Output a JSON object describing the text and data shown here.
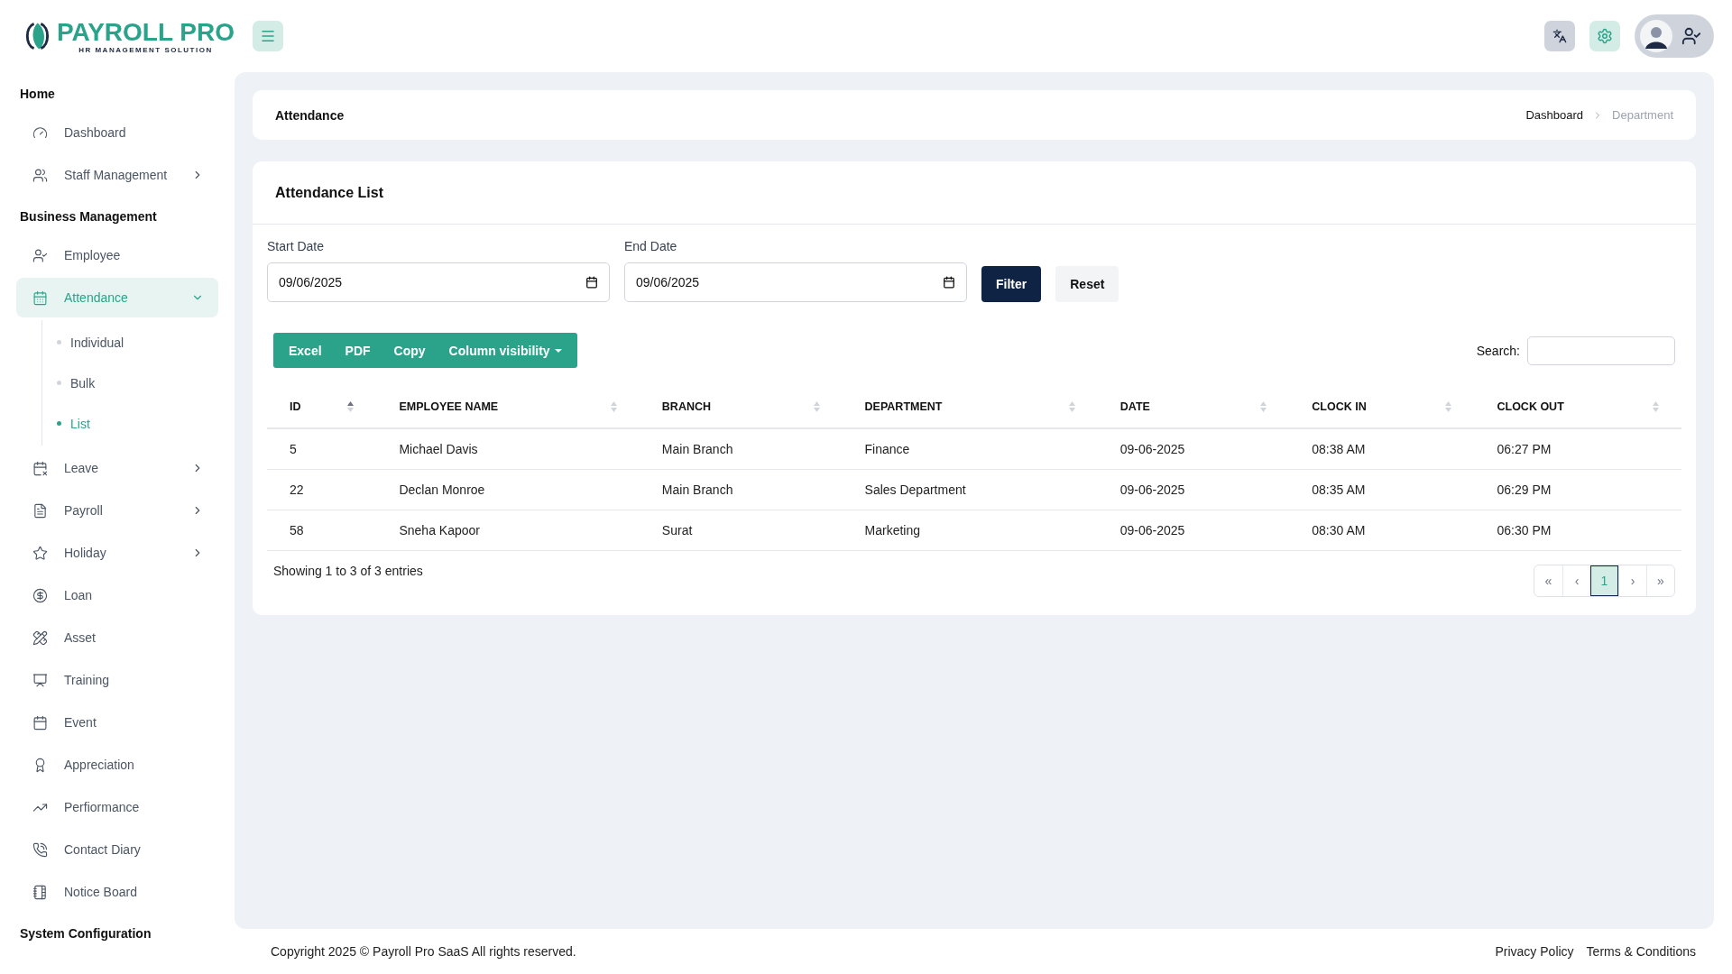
{
  "logo": {
    "name": "PAYROLL PRO",
    "tagline": "HR MANAGEMENT SOLUTION"
  },
  "sidebar": {
    "sections": [
      {
        "title": "Home",
        "items": [
          {
            "label": "Dashboard",
            "kind": "link",
            "selected": false
          },
          {
            "label": "Staff Management",
            "kind": "menu",
            "expanded": false,
            "selected": false
          }
        ]
      },
      {
        "title": "Business Management",
        "items": [
          {
            "label": "Employee",
            "kind": "link",
            "selected": false
          },
          {
            "label": "Attendance",
            "kind": "menu",
            "expanded": true,
            "selected": true,
            "children": [
              {
                "label": "Individual",
                "selected": false
              },
              {
                "label": "Bulk",
                "selected": false
              },
              {
                "label": "List",
                "selected": true
              }
            ]
          },
          {
            "label": "Leave",
            "kind": "menu",
            "expanded": false,
            "selected": false
          },
          {
            "label": "Payroll",
            "kind": "menu",
            "expanded": false,
            "selected": false
          },
          {
            "label": "Holiday",
            "kind": "menu",
            "expanded": false,
            "selected": false
          },
          {
            "label": "Loan",
            "kind": "link",
            "selected": false
          },
          {
            "label": "Asset",
            "kind": "link",
            "selected": false
          },
          {
            "label": "Training",
            "kind": "link",
            "selected": false
          },
          {
            "label": "Event",
            "kind": "link",
            "selected": false
          },
          {
            "label": "Appreciation",
            "kind": "link",
            "selected": false
          },
          {
            "label": "Perfiormance",
            "kind": "link",
            "selected": false
          },
          {
            "label": "Contact Diary",
            "kind": "link",
            "selected": false
          },
          {
            "label": "Notice Board",
            "kind": "link",
            "selected": false
          }
        ]
      },
      {
        "title": "System Configuration"
      }
    ]
  },
  "page_header": {
    "title": "Attendance",
    "breadcrumb": [
      {
        "label": "Dashboard",
        "current": false
      },
      {
        "label": "Department",
        "current": true
      }
    ]
  },
  "card": {
    "title": "Attendance List",
    "filters": [
      {
        "label": "Start Date",
        "value": "09/06/2025"
      },
      {
        "label": "End Date",
        "value": "09/06/2025"
      }
    ],
    "filter_buttons": [
      {
        "label": "Filter",
        "kind": "primary"
      },
      {
        "label": "Reset",
        "kind": "secondary"
      }
    ],
    "export_buttons": [
      {
        "label": "Excel",
        "kind": "plain"
      },
      {
        "label": "PDF",
        "kind": "plain"
      },
      {
        "label": "Copy",
        "kind": "plain"
      },
      {
        "label": "Column visibility",
        "kind": "dropdown"
      }
    ],
    "search_label": "Search:",
    "table": {
      "columns": [
        {
          "label": "ID",
          "sorted": true
        },
        {
          "label": "EMPLOYEE NAME",
          "sorted": false
        },
        {
          "label": "BRANCH",
          "sorted": false
        },
        {
          "label": "DEPARTMENT",
          "sorted": false
        },
        {
          "label": "DATE",
          "sorted": false
        },
        {
          "label": "CLOCK IN",
          "sorted": false
        },
        {
          "label": "CLOCK OUT",
          "sorted": false
        }
      ],
      "rows": [
        [
          "5",
          "Michael Davis",
          "Main Branch",
          "Finance",
          "09-06-2025",
          "08:38 AM",
          "06:27 PM"
        ],
        [
          "22",
          "Declan Monroe",
          "Main Branch",
          "Sales Department",
          "09-06-2025",
          "08:35 AM",
          "06:29 PM"
        ],
        [
          "58",
          "Sneha Kapoor",
          "Surat",
          "Marketing",
          "09-06-2025",
          "08:30 AM",
          "06:30 PM"
        ]
      ]
    },
    "info": "Showing 1 to 3 of 3 entries",
    "pagination": [
      {
        "label": "«",
        "selected": false
      },
      {
        "label": "‹",
        "selected": false
      },
      {
        "label": "1",
        "selected": true
      },
      {
        "label": "›",
        "selected": false
      },
      {
        "label": "»",
        "selected": false
      }
    ]
  },
  "footer": {
    "copyright": "Copyright 2025 © Payroll Pro SaaS All rights reserved.",
    "links": [
      "Privacy Policy",
      "Terms & Conditions"
    ]
  }
}
